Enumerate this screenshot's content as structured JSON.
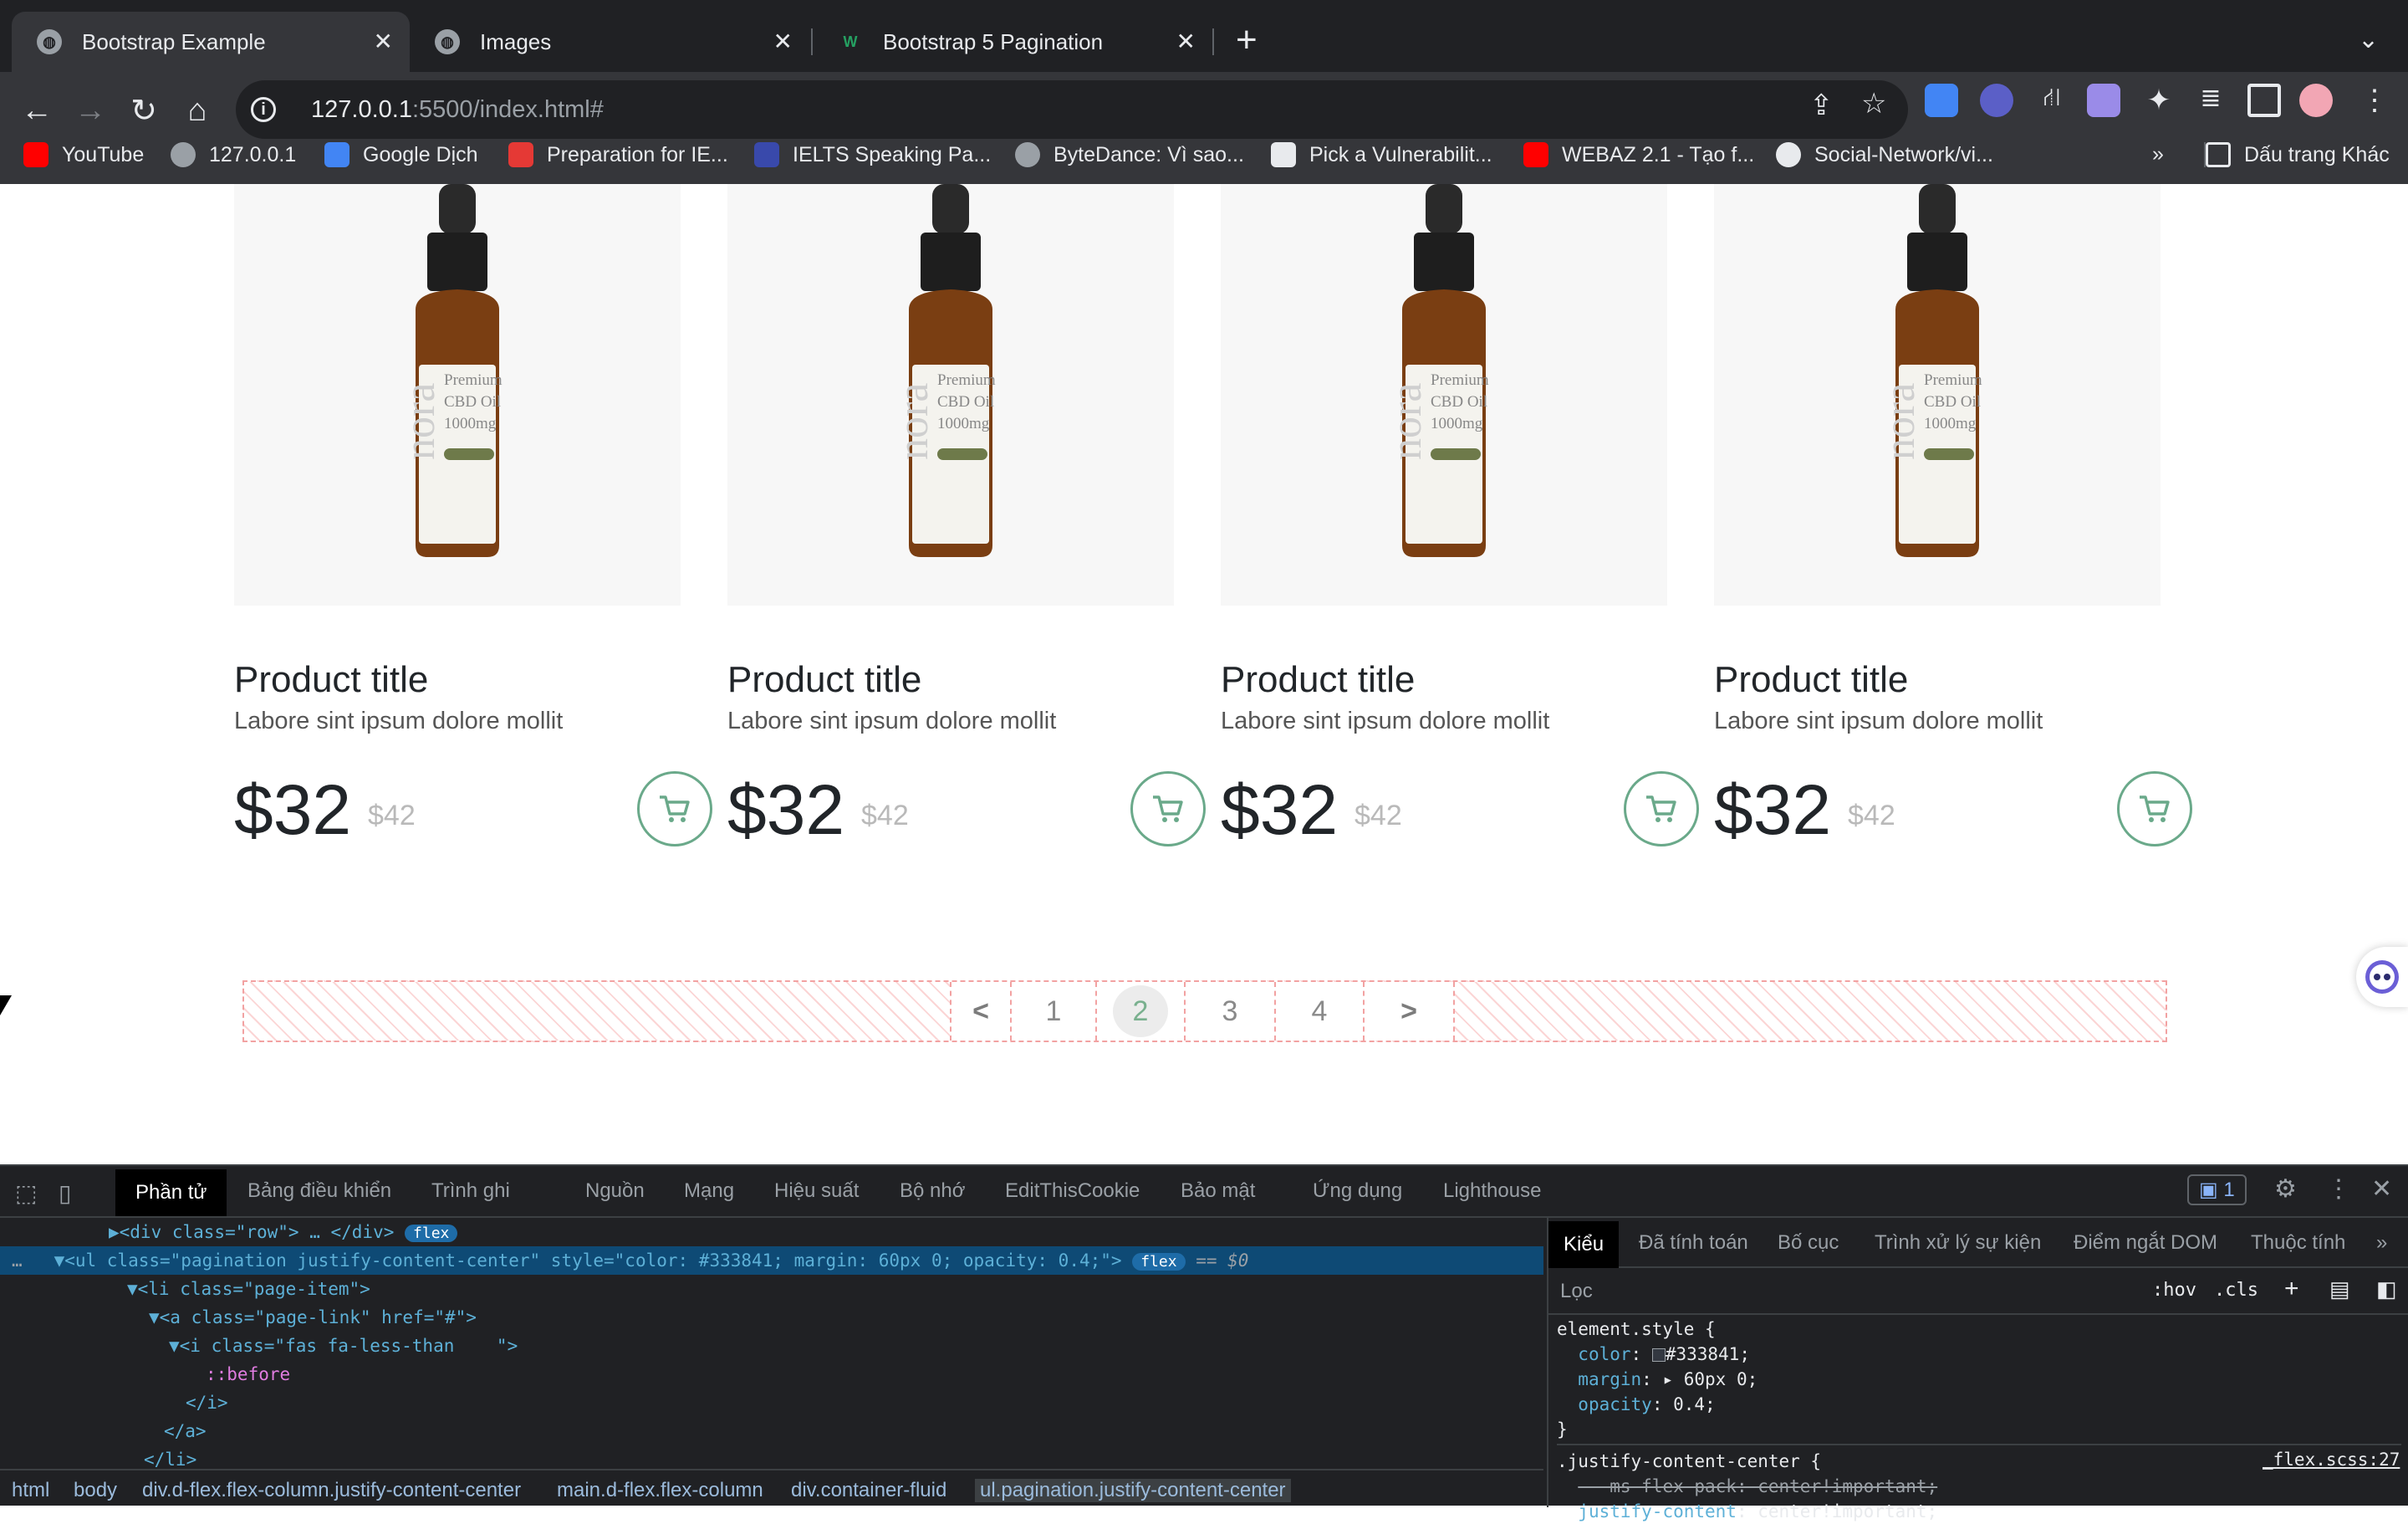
{
  "browser": {
    "tabs": [
      {
        "title": "Bootstrap Example",
        "active": true
      },
      {
        "title": "Images",
        "active": false
      },
      {
        "title": "Bootstrap 5 Pagination",
        "active": false
      }
    ],
    "url_host": "127.0.0.1",
    "url_rest": ":5500/index.html#",
    "bookmarks": [
      {
        "label": "YouTube",
        "icon": "youtube-icon",
        "color": "#ff0000"
      },
      {
        "label": "127.0.0.1",
        "icon": "globe-icon",
        "color": "#9aa0a6"
      },
      {
        "label": "Google Dịch",
        "icon": "google-translate-icon",
        "color": "#4285f4"
      },
      {
        "label": "Preparation for IE...",
        "icon": "grid-icon",
        "color": "#e53935"
      },
      {
        "label": "IELTS Speaking Pa...",
        "icon": "m-logo-icon",
        "color": "#3949ab"
      },
      {
        "label": "ByteDance: Vì sao...",
        "icon": "globe-icon",
        "color": "#9aa0a6"
      },
      {
        "label": "Pick a Vulnerabilit...",
        "icon": "ha-logo-icon",
        "color": "#e8eaed"
      },
      {
        "label": "WEBAZ 2.1 - Tạo f...",
        "icon": "youtube-icon",
        "color": "#ff0000"
      },
      {
        "label": "Social-Network/vi...",
        "icon": "github-icon",
        "color": "#e8eaed"
      }
    ],
    "bookmarks_more": "»",
    "other_bookmarks": "Dấu trang Khác"
  },
  "products": [
    {
      "title": "Product title",
      "desc": "Labore sint ipsum dolore mollit",
      "price": "$32",
      "old_price": "$42",
      "bottle_text": [
        "Premium",
        "CBD Oil",
        "1000mg"
      ]
    },
    {
      "title": "Product title",
      "desc": "Labore sint ipsum dolore mollit",
      "price": "$32",
      "old_price": "$42",
      "bottle_text": [
        "Premium",
        "CBD Oil",
        "1000mg"
      ]
    },
    {
      "title": "Product title",
      "desc": "Labore sint ipsum dolore mollit",
      "price": "$32",
      "old_price": "$42",
      "bottle_text": [
        "Premium",
        "CBD Oil",
        "1000mg"
      ]
    },
    {
      "title": "Product title",
      "desc": "Labore sint ipsum dolore mollit",
      "price": "$32",
      "old_price": "$42",
      "bottle_text": [
        "Premium",
        "CBD Oil",
        "1000mg"
      ]
    }
  ],
  "brand_text": "nora",
  "pagination": {
    "prev": "<",
    "pages": [
      "1",
      "2",
      "3",
      "4"
    ],
    "current": "2",
    "next": ">"
  },
  "devtools": {
    "tabs": [
      "Phần tử",
      "Bảng điều khiển",
      "Trình ghi",
      "Nguồn",
      "Mạng",
      "Hiệu suất",
      "Bộ nhớ",
      "EditThisCookie",
      "Bảo mật",
      "Ứng dụng",
      "Lighthouse"
    ],
    "issues_count": "1",
    "dom_lines": [
      {
        "indent": 0,
        "text": "▶<div class=\"row\"> … </div>",
        "badge": "flex"
      },
      {
        "indent": 0,
        "text": "▼<ul class=\"pagination justify-content-center\" style=\"color: #333841; margin: 60px 0; opacity: 0.4;\">",
        "badge": "flex",
        "suffix": "== $0",
        "selected": true
      },
      {
        "indent": 1,
        "text": "▼<li class=\"page-item\">"
      },
      {
        "indent": 2,
        "text": "▼<a class=\"page-link\" href=\"#\">"
      },
      {
        "indent": 3,
        "text": "▼<i class=\"fas fa-less-than    \">"
      },
      {
        "indent": 4,
        "text": "::before",
        "pseudo": true
      },
      {
        "indent": 3,
        "text": "</i>"
      },
      {
        "indent": 2,
        "text": "</a>"
      },
      {
        "indent": 1,
        "text": "</li>"
      }
    ],
    "styles_tabs": [
      "Kiểu",
      "Đã tính toán",
      "Bố cục",
      "Trình xử lý sự kiện",
      "Điểm ngắt DOM",
      "Thuộc tính"
    ],
    "filter_placeholder": "Lọc",
    "hov": ":hov",
    "cls": ".cls",
    "rules": [
      "element.style {",
      "  color: ▢#333841;",
      "  margin: ▸ 60px 0;",
      "  opacity: 0.4;",
      "}",
      ".justify-content-center {",
      "  -ms-flex-pack: center!important;",
      "  justify-content: center!important;"
    ],
    "rule_source": "_flex.scss:27",
    "breadcrumbs": [
      "html",
      "body",
      "div.d-flex.flex-column.justify-content-center",
      "main.d-flex.flex-column",
      "div.container-fluid",
      "ul.pagination.justify-content-center"
    ]
  }
}
